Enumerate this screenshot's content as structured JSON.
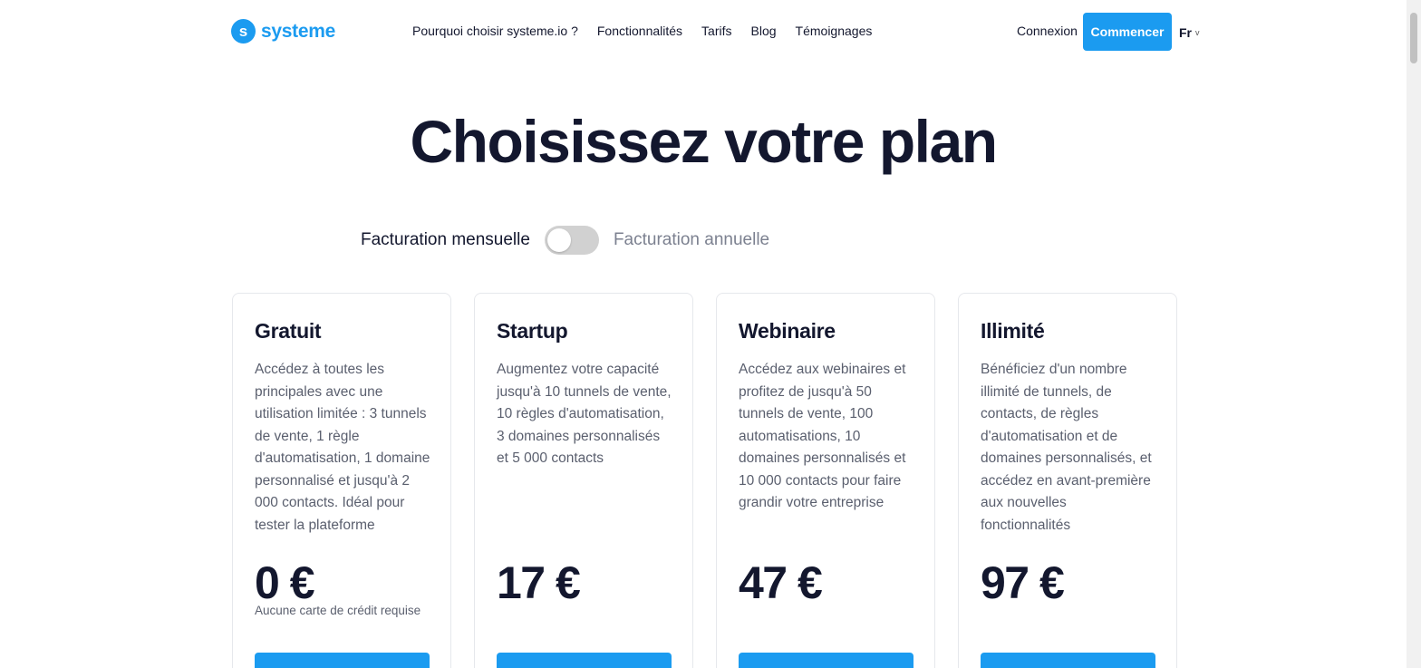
{
  "header": {
    "logo_mark": "s",
    "logo_text": "systeme",
    "nav": [
      {
        "label": "Pourquoi choisir systeme.io ?"
      },
      {
        "label": "Fonctionnalités"
      },
      {
        "label": "Tarifs"
      },
      {
        "label": "Blog"
      },
      {
        "label": "Témoignages"
      }
    ],
    "login_label": "Connexion",
    "cta_label": "Commencer",
    "language": "Fr"
  },
  "main": {
    "title": "Choisissez votre plan",
    "billing": {
      "monthly_label": "Facturation mensuelle",
      "annual_label": "Facturation annuelle",
      "annual_selected": false
    },
    "plans": [
      {
        "name": "Gratuit",
        "description": "Accédez à toutes les principales avec une utilisation limitée : 3 tunnels de vente, 1 règle d'automatisation, 1 domaine personnalisé et jusqu'à 2 000 contacts. Idéal pour tester la plateforme",
        "price": "0 €",
        "note": "Aucune carte de crédit requise"
      },
      {
        "name": "Startup",
        "description": "Augmentez votre capacité jusqu'à 10 tunnels de vente, 10 règles d'automatisation, 3 domaines personnalisés et 5 000 contacts",
        "price": "17 €",
        "note": ""
      },
      {
        "name": "Webinaire",
        "description": "Accédez aux webinaires et profitez de jusqu'à 50 tunnels de vente, 100 automatisations, 10 domaines personnalisés et 10 000 contacts pour faire grandir votre entreprise",
        "price": "47 €",
        "note": ""
      },
      {
        "name": "Illimité",
        "description": "Bénéficiez d'un nombre illimité de tunnels, de contacts, de règles d'automatisation et de domaines personnalisés, et accédez en avant-première aux nouvelles fonctionnalités",
        "price": "97 €",
        "note": ""
      }
    ]
  },
  "colors": {
    "brand": "#1b9bf0",
    "heading": "#13172e",
    "body_text": "#5a5f6e",
    "toggle_off": "#d1d1d1"
  },
  "icons": {
    "logo": "systeme-logo-icon",
    "language_dropdown": "chevron-down-icon"
  }
}
